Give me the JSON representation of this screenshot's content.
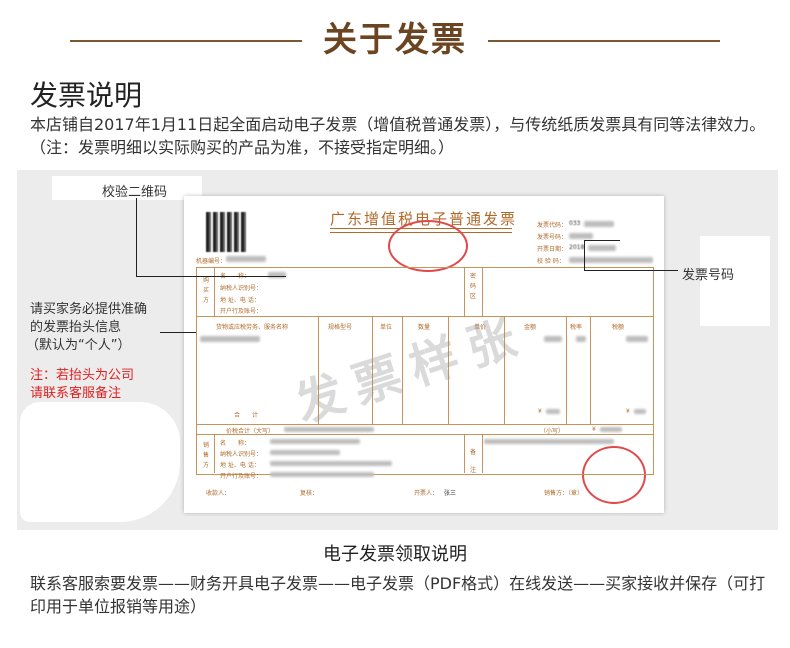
{
  "header": {
    "title": "关于发票"
  },
  "section": {
    "title": "发票说明",
    "text": "本店铺自2017年1月11日起全面启动电子发票（增值税普通发票），与传统纸质发票具有同等法律效力。（注：发票明细以实际购买的产品为准，不接受指定明细。）"
  },
  "invoice": {
    "title": "广东增值税电子普通发票",
    "machine_no_label": "机器编号：",
    "right_labels": [
      "发票代码：",
      "发票号码：",
      "开票日期：",
      "校 验 码："
    ],
    "right_values": [
      "033",
      "",
      "2018",
      ""
    ],
    "buyer_side": "购买方",
    "buyer_rows": [
      "名　　称：",
      "纳税人识别号：",
      "地 址、电 话：",
      "开户行及账号："
    ],
    "password_area": "密码区",
    "columns": [
      "货物或应税劳务、服务名称",
      "规格型号",
      "单位",
      "数量",
      "单价",
      "金额",
      "税率",
      "税额"
    ],
    "total_label": "合　　计",
    "total_amount": "¥",
    "total_tax": "¥",
    "tax_total_label": "价税合计（大写）",
    "small_label": "（小写）",
    "small_amount": "¥",
    "seller_side": "销售方",
    "seller_rows": [
      "名　　称：",
      "纳税人识别号：",
      "地 址、电 话：",
      "开户行及账号："
    ],
    "remark": "备注",
    "footer": [
      "收款人：",
      "复核：",
      "开票人：",
      "销售方：（章）"
    ],
    "footer_issuer": "张三",
    "watermark": "发票样张"
  },
  "callouts": {
    "qr": "校验二维码",
    "invoice_no": "发票号码",
    "buyer_info": [
      "请买家务必提供准确",
      "的发票抬头信息",
      "（默认为“个人”）"
    ],
    "note": [
      "注：若抬头为公司",
      "请联系客服备注"
    ]
  },
  "colors": {
    "brand": "#6b4522",
    "invoice": "#b06a2a",
    "stamp": "#e04a4a",
    "note": "#e02020"
  },
  "bottom": {
    "title": "电子发票领取说明",
    "text": "联系客服索要发票——财务开具电子发票——电子发票（PDF格式）在线发送——买家接收并保存（可打印用于单位报销等用途）"
  }
}
